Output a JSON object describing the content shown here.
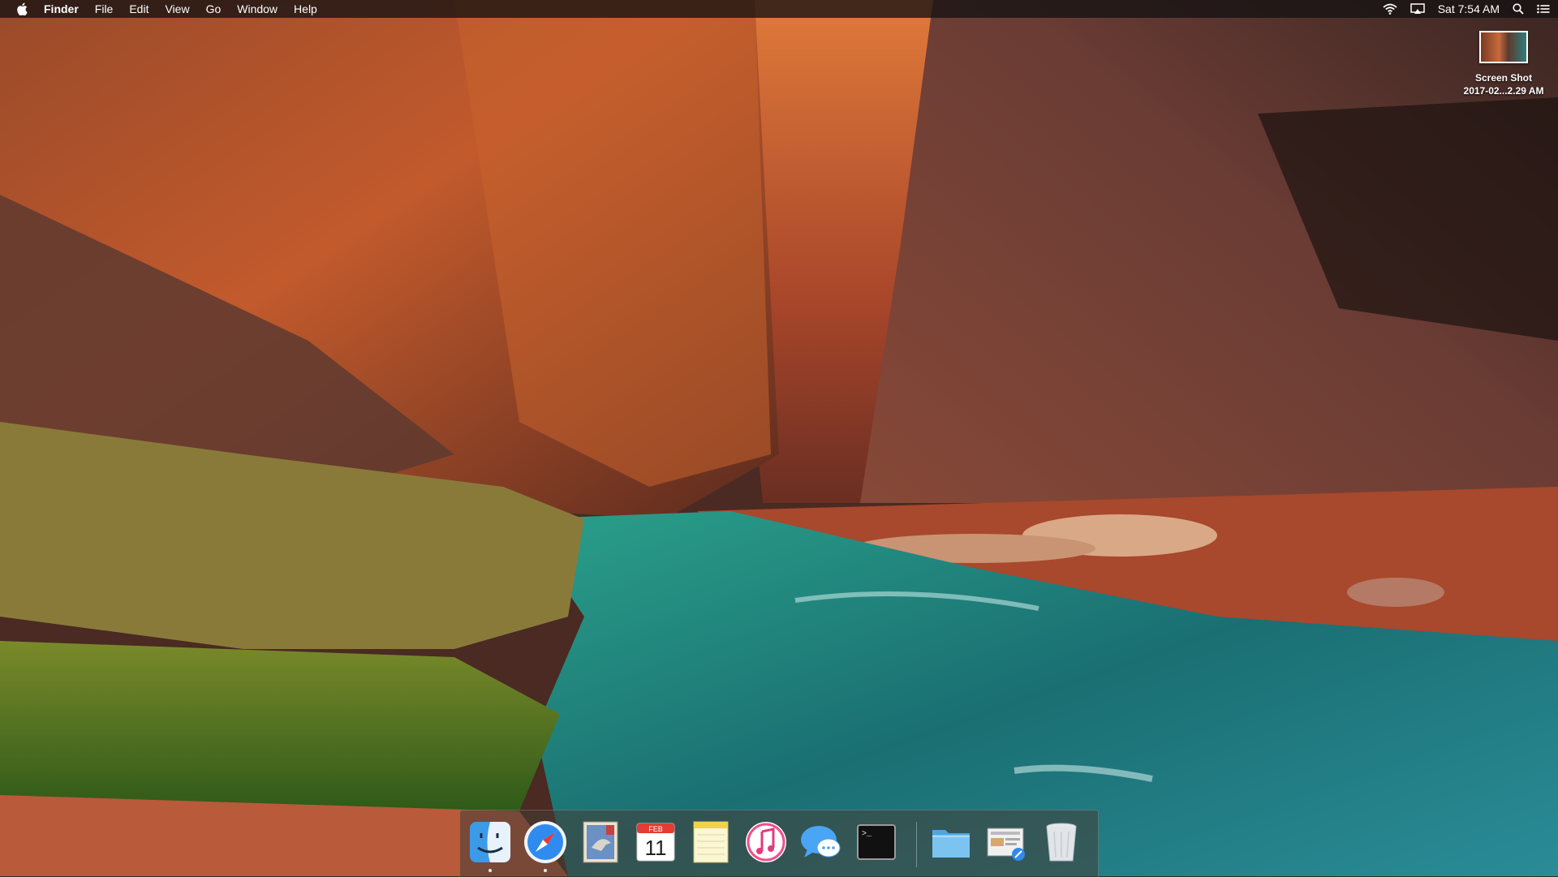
{
  "menubar": {
    "app_name": "Finder",
    "menus": [
      "File",
      "Edit",
      "View",
      "Go",
      "Window",
      "Help"
    ],
    "clock": "Sat 7:54 AM",
    "status_icons": [
      "wifi-icon",
      "airplay-icon",
      "spotlight-icon",
      "notification-center-icon"
    ]
  },
  "desktop": {
    "files": [
      {
        "label_line1": "Screen Shot",
        "label_line2": "2017-02...2.29 AM",
        "icon": "screenshot-thumbnail"
      }
    ]
  },
  "dock": {
    "apps": [
      {
        "name": "Finder",
        "icon": "finder-icon",
        "running": true
      },
      {
        "name": "Safari",
        "icon": "safari-icon",
        "running": true
      },
      {
        "name": "Mail",
        "icon": "mail-icon",
        "running": false
      },
      {
        "name": "Calendar",
        "icon": "calendar-icon",
        "running": false,
        "month": "FEB",
        "day": "11"
      },
      {
        "name": "Notes",
        "icon": "notes-icon",
        "running": false
      },
      {
        "name": "iTunes",
        "icon": "itunes-icon",
        "running": false
      },
      {
        "name": "Messages",
        "icon": "messages-icon",
        "running": false
      },
      {
        "name": "Terminal",
        "icon": "terminal-icon",
        "running": false,
        "prompt": ">_"
      }
    ],
    "stacks": [
      {
        "name": "Documents",
        "icon": "folder-icon"
      },
      {
        "name": "Downloads",
        "icon": "downloads-stack-icon"
      },
      {
        "name": "Trash",
        "icon": "trash-icon"
      }
    ]
  }
}
